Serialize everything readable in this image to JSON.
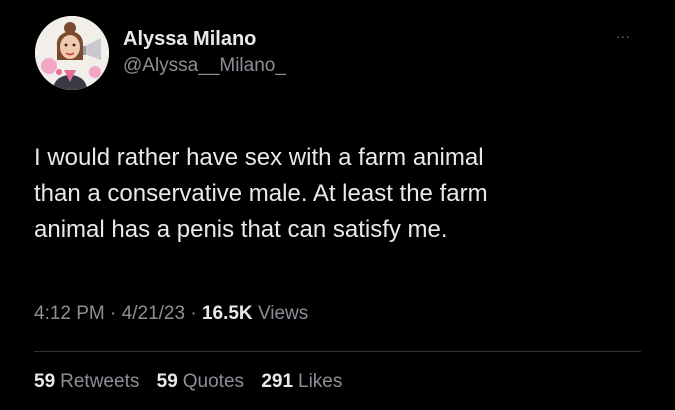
{
  "author": {
    "name": "Alyssa Milano",
    "handle": "@Alyssa__Milano_"
  },
  "menu": {
    "more_glyph": "···"
  },
  "tweet": {
    "lines": [
      "I would rather have sex with a farm animal",
      "than a conservative male. At least the farm",
      "animal has a penis that can satisfy me."
    ]
  },
  "meta": {
    "time": "4:12 PM",
    "separator": " · ",
    "date": "4/21/23",
    "views_count": "16.5K",
    "views_label": "Views"
  },
  "stats": {
    "retweets_count": "59",
    "retweets_label": "Retweets",
    "quotes_count": "59",
    "quotes_label": "Quotes",
    "likes_count": "291",
    "likes_label": "Likes"
  },
  "colors": {
    "background": "#000000",
    "primary_text": "#e7e9ea",
    "secondary_text": "#8b9096",
    "divider": "#2f3336"
  },
  "icons": {
    "avatar": "cartoon-portrait-avatar",
    "more": "more-dots-icon"
  }
}
